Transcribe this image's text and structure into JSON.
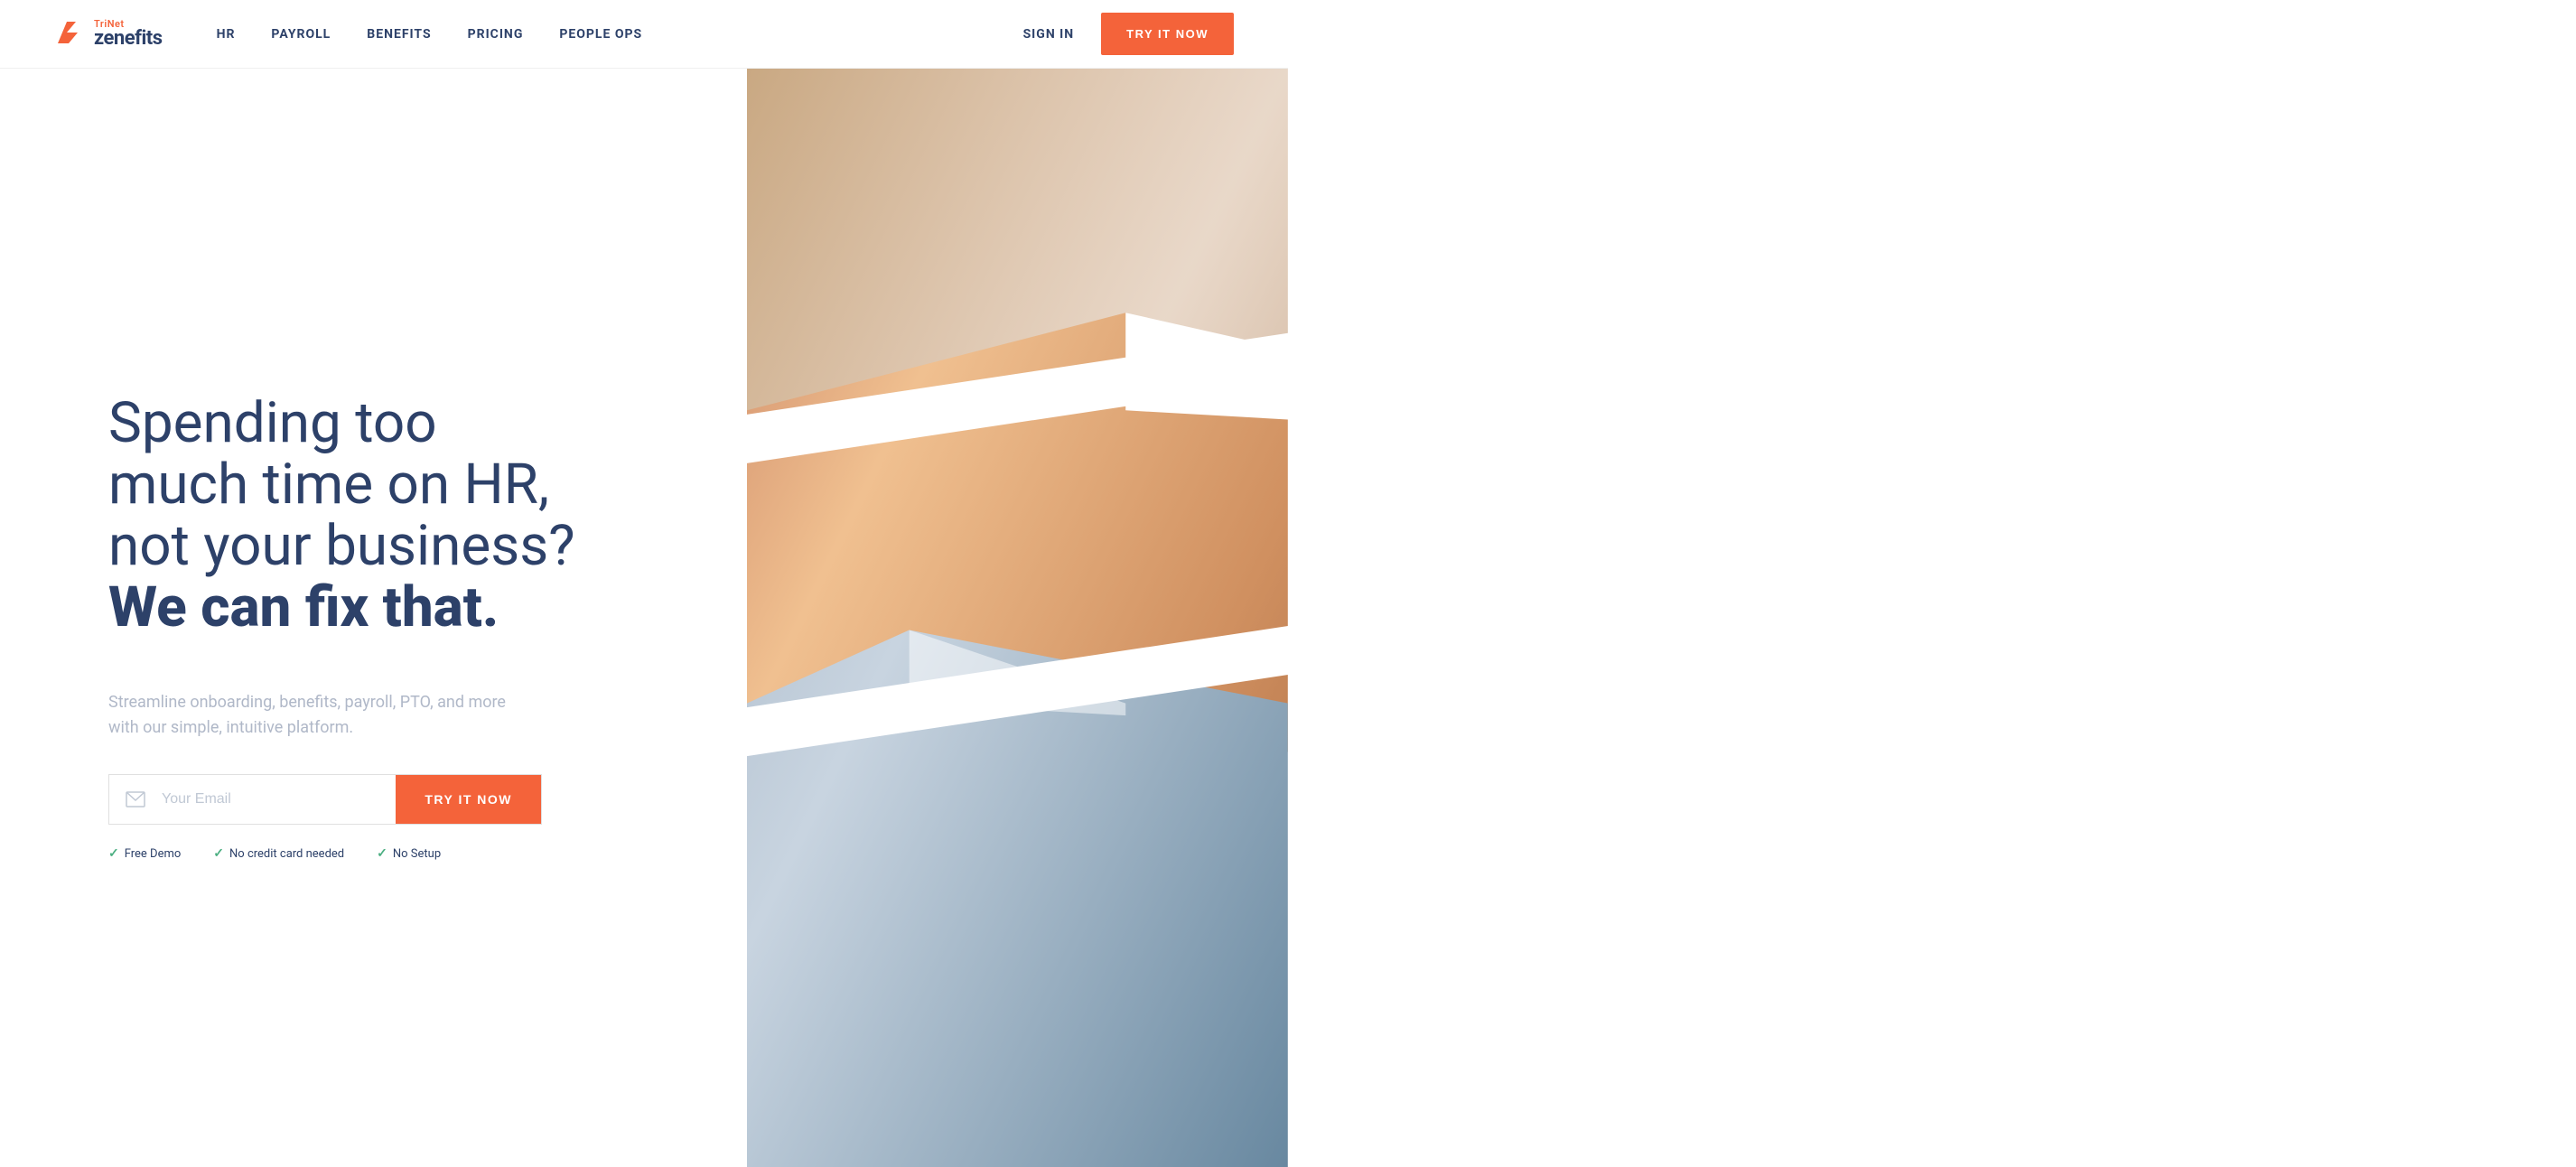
{
  "logo": {
    "trinet": "TriNet",
    "zenefits": "zenefits"
  },
  "nav": {
    "links": [
      {
        "label": "HR",
        "id": "hr"
      },
      {
        "label": "PAYROLL",
        "id": "payroll"
      },
      {
        "label": "BENEFITS",
        "id": "benefits"
      },
      {
        "label": "PRICING",
        "id": "pricing"
      },
      {
        "label": "PEOPLE OPS",
        "id": "people-ops"
      }
    ],
    "sign_in": "SIGN IN",
    "try_it_now": "TRY IT NOW"
  },
  "hero": {
    "headline_line1": "Spending too",
    "headline_line2": "much time on HR,",
    "headline_line3": "not your business?",
    "headline_bold": "We can fix that.",
    "subtext": "Streamline onboarding, benefits, payroll, PTO, and more with our simple, intuitive platform.",
    "email_placeholder": "Your Email",
    "cta_button": "TRY IT NOW",
    "perks": [
      {
        "label": "Free Demo"
      },
      {
        "label": "No credit card needed"
      },
      {
        "label": "No Setup"
      }
    ]
  },
  "colors": {
    "primary": "#f4633a",
    "navy": "#2d4169",
    "gray_text": "#b0b8c8",
    "green_check": "#4caf82"
  }
}
